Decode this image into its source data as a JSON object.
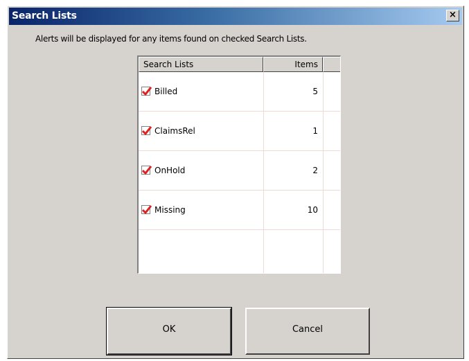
{
  "window": {
    "title": "Search Lists",
    "close_glyph": "×"
  },
  "message": "Alerts will be displayed for any items found on checked Search Lists.",
  "list": {
    "columns": [
      "Search Lists",
      "Items"
    ],
    "rows": [
      {
        "name": "Billed",
        "items": "5",
        "checked": true
      },
      {
        "name": "ClaimsRel",
        "items": "1",
        "checked": true
      },
      {
        "name": "OnHold",
        "items": "2",
        "checked": true
      },
      {
        "name": "Missing",
        "items": "10",
        "checked": true
      }
    ]
  },
  "buttons": {
    "ok_label": "OK",
    "cancel_label": "Cancel"
  },
  "colors": {
    "title_gradient_start": "#0a246a",
    "title_gradient_end": "#a6caf0",
    "dialog_bg": "#d6d3ce",
    "check_mark": "#e02020",
    "grid_line": "#f0d8d4"
  },
  "icons": {
    "close": "close-icon",
    "check": "check-icon"
  }
}
